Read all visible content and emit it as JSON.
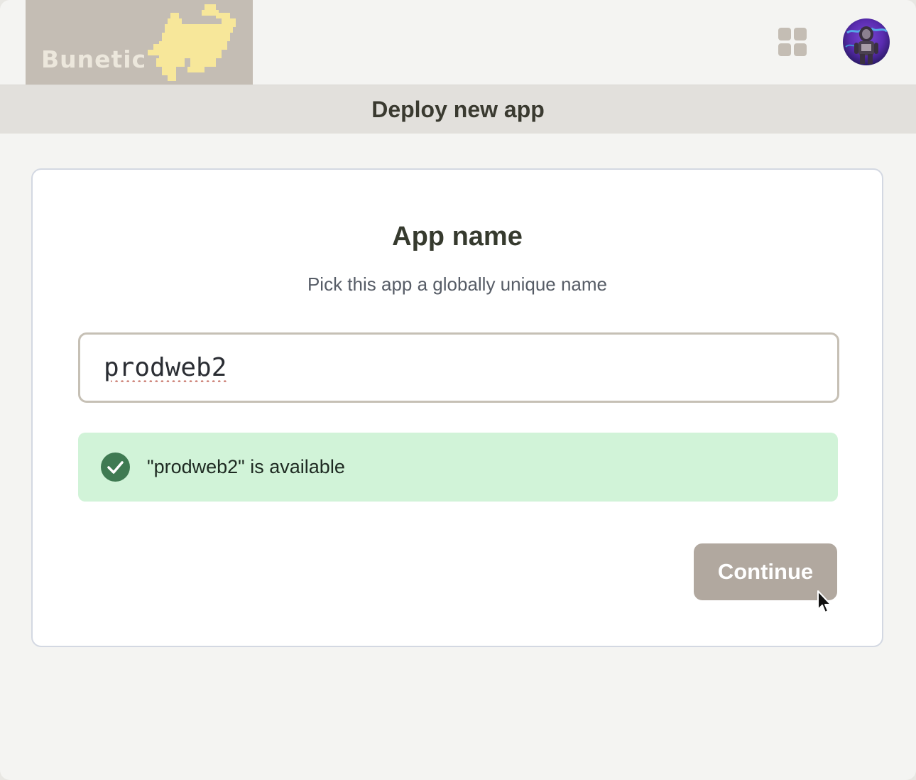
{
  "header": {
    "logo_text": "Bunetic",
    "apps_icon": "grid-icon",
    "avatar_icon": "user-avatar"
  },
  "subheader": {
    "title": "Deploy new app"
  },
  "form": {
    "title": "App name",
    "subtitle": "Pick this app a globally unique name",
    "input_value": "prodweb2",
    "availability_message": "\"prodweb2\" is available",
    "availability_icon": "check-circle-icon",
    "continue_label": "Continue"
  },
  "colors": {
    "logo_bg": "#c4bdb4",
    "logo_bunny": "#f7e79a",
    "success_bg": "#d1f3d8",
    "success_icon": "#3f7a52",
    "button_bg": "#b1a89f"
  }
}
